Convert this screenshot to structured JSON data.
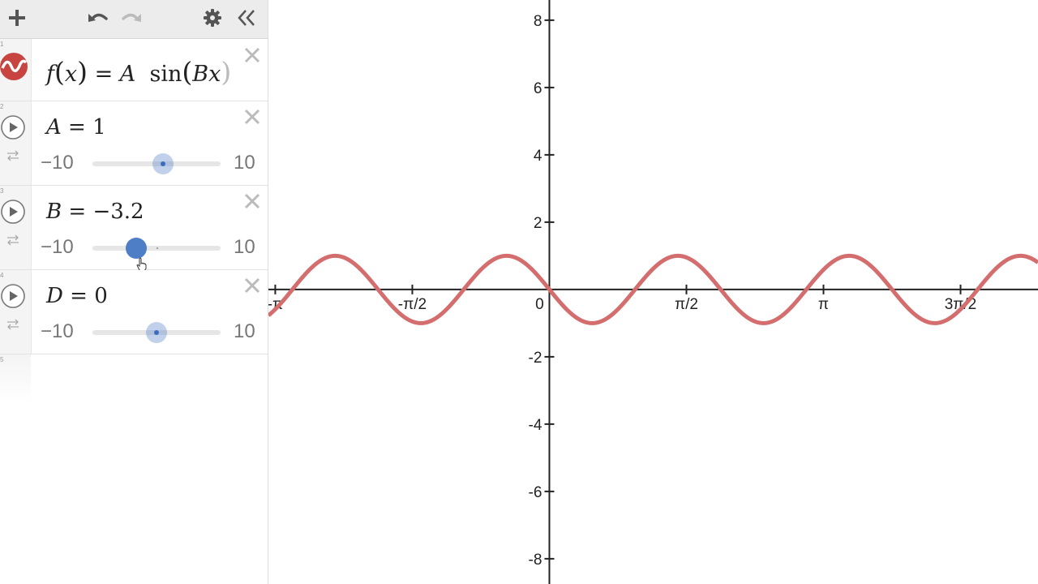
{
  "toolbar": {
    "buttons": [
      "add-icon",
      "undo-icon",
      "redo-icon",
      "gear-icon",
      "collapse-icon"
    ]
  },
  "expressions": [
    {
      "index": "1",
      "latex": "f(x) = A sin(Bx",
      "parts": {
        "fname": "f",
        "var": "x",
        "eq": "=",
        "coef": "A",
        "func": "sin",
        "arg": "Bx"
      },
      "color": "#c74440"
    },
    {
      "index": "2",
      "name": "A",
      "eq": "=",
      "value": "1",
      "min": "−10",
      "max": "10",
      "fraction": 0.55,
      "active": false
    },
    {
      "index": "3",
      "name": "B",
      "eq": "=",
      "value": "−3.2",
      "min": "−10",
      "max": "10",
      "fraction": 0.34,
      "active": true
    },
    {
      "index": "4",
      "name": "D",
      "eq": "=",
      "value": "0",
      "min": "−10",
      "max": "10",
      "fraction": 0.5,
      "active": false
    },
    {
      "index": "5"
    }
  ],
  "graph": {
    "x_tick_labels": [
      "-π",
      "-π/2",
      "0",
      "π/2",
      "π",
      "3π/2"
    ],
    "y_tick_labels": [
      "8",
      "6",
      "4",
      "2",
      "-2",
      "-4",
      "-6",
      "-8"
    ],
    "curve_color": "#d46e6e"
  },
  "chart_data": {
    "type": "line",
    "series": [
      {
        "function": "y = 1*sin(-3.2x)",
        "A": 1,
        "B": -3.2
      }
    ],
    "x_ticks": [
      -3.14159,
      -1.5708,
      0,
      1.5708,
      3.14159,
      4.71239
    ],
    "y_ticks": [
      8,
      6,
      4,
      2,
      -2,
      -4,
      -6,
      -8
    ],
    "xlim": [
      -3.22,
      5.6
    ],
    "ylim": [
      -8.75,
      8.6
    ],
    "grid": false
  }
}
